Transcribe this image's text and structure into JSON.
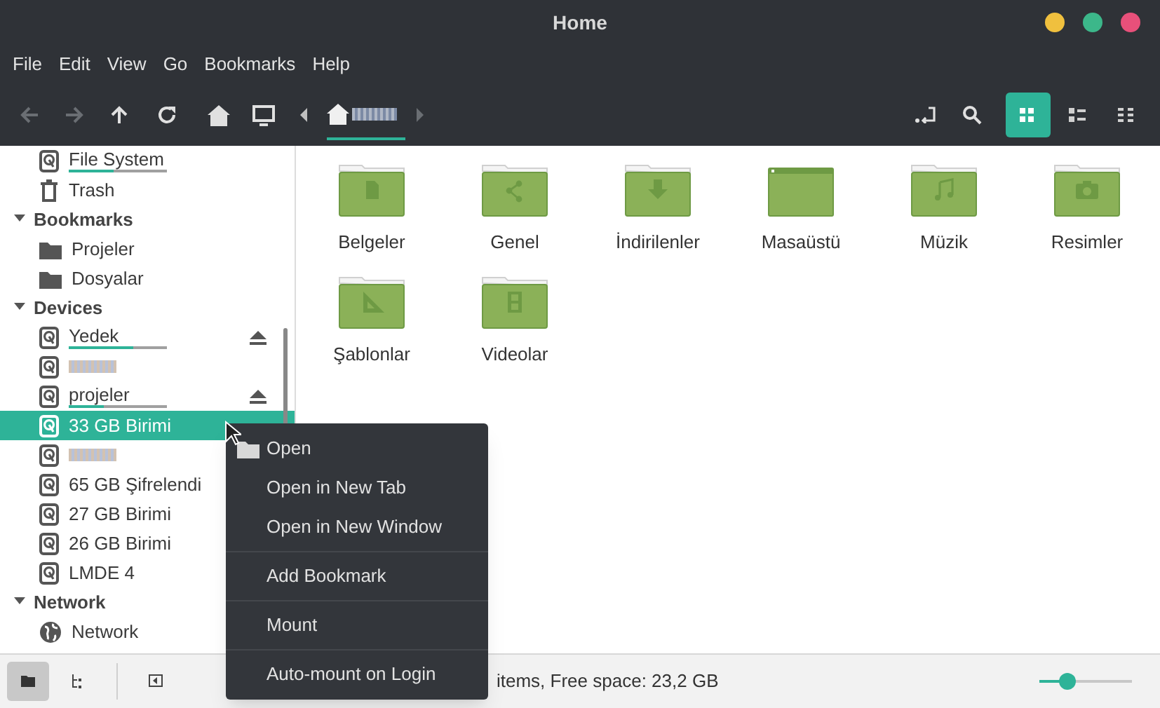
{
  "window": {
    "title": "Home"
  },
  "menu_bar": [
    "File",
    "Edit",
    "View",
    "Go",
    "Bookmarks",
    "Help"
  ],
  "toolbar": {
    "view_modes": [
      {
        "kind": "icons",
        "selected": true
      },
      {
        "kind": "list",
        "selected": false
      },
      {
        "kind": "compact",
        "selected": false
      }
    ]
  },
  "sidebar": {
    "sections": [
      {
        "kind": "places",
        "items": [
          {
            "label": "File System",
            "kind": "drive",
            "usage": {
              "level": 0.45
            },
            "selected": false
          },
          {
            "label": "Trash",
            "kind": "trash",
            "selected": false
          }
        ]
      },
      {
        "kind": "section",
        "label": "Bookmarks",
        "expanded": true,
        "items": [
          {
            "label": "Projeler",
            "kind": "folder",
            "selected": false
          },
          {
            "label": "Dosyalar",
            "kind": "folder",
            "selected": false
          }
        ]
      },
      {
        "kind": "section",
        "label": "Devices",
        "expanded": true,
        "items": [
          {
            "label": "Yedek",
            "kind": "drive",
            "usage": {
              "level": 0.65
            },
            "eject": true,
            "selected": false
          },
          {
            "kind": "drive",
            "redacted": true,
            "selected": false
          },
          {
            "label": "projeler",
            "kind": "drive",
            "usage": {
              "level": 0.35
            },
            "eject": true,
            "selected": false
          },
          {
            "label": "33 GB Birimi",
            "kind": "drive",
            "selected": true
          },
          {
            "kind": "drive",
            "redacted": true,
            "selected": false
          },
          {
            "label": "65 GB Şifrelendi",
            "kind": "drive",
            "selected": false
          },
          {
            "label": "27 GB Birimi",
            "kind": "drive",
            "selected": false
          },
          {
            "label": "26 GB Birimi",
            "kind": "drive",
            "selected": false
          },
          {
            "label": "LMDE 4",
            "kind": "drive",
            "selected": false
          }
        ]
      },
      {
        "kind": "section",
        "label": "Network",
        "expanded": true,
        "items": [
          {
            "label": "Network",
            "kind": "globe",
            "selected": false
          }
        ]
      }
    ]
  },
  "files": [
    {
      "name": "Belgeler",
      "kind": "documents"
    },
    {
      "name": "Genel",
      "kind": "share"
    },
    {
      "name": "İndirilenler",
      "kind": "download"
    },
    {
      "name": "Masaüstü",
      "kind": "desktop"
    },
    {
      "name": "Müzik",
      "kind": "music"
    },
    {
      "name": "Resimler",
      "kind": "pictures"
    },
    {
      "name": "Şablonlar",
      "kind": "templates"
    },
    {
      "name": "Videolar",
      "kind": "videos"
    }
  ],
  "context_menu": {
    "groups": [
      [
        {
          "label": "Open",
          "kind": "folder"
        },
        {
          "label": "Open in New Tab"
        },
        {
          "label": "Open in New Window"
        }
      ],
      [
        {
          "label": "Add Bookmark"
        }
      ],
      [
        {
          "label": "Mount"
        }
      ],
      [
        {
          "label": "Auto-mount on Login"
        }
      ]
    ]
  },
  "status_bar": {
    "text": "items, Free space: 23,2 GB",
    "zoom": {
      "level": 0.3
    },
    "pane_buttons": [
      {
        "kind": "places",
        "selected": true
      },
      {
        "kind": "tree",
        "selected": false
      },
      {
        "kind": "toggle",
        "selected": false
      }
    ]
  }
}
